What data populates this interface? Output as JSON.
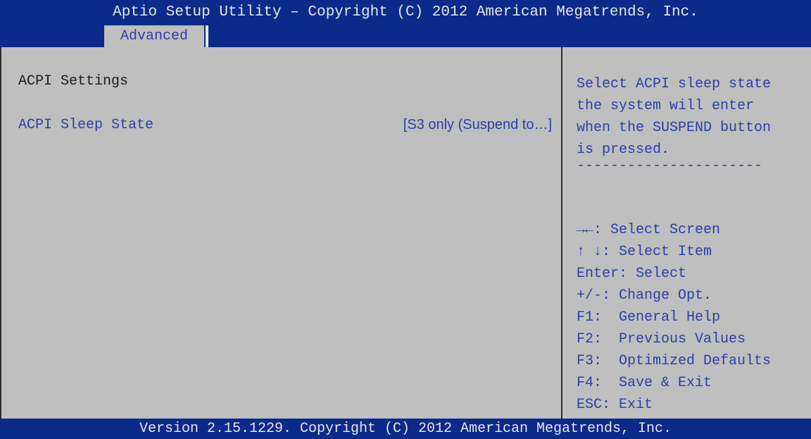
{
  "header": {
    "title": "Aptio Setup Utility – Copyright (C) 2012 American Megatrends, Inc."
  },
  "tabs": [
    {
      "label": "Advanced",
      "selected": true
    }
  ],
  "main": {
    "section_title": "ACPI Settings",
    "settings": [
      {
        "label": "ACPI Sleep State",
        "value": "[S3 only (Suspend to…]"
      }
    ]
  },
  "help": {
    "description_lines": [
      "Select ACPI sleep state",
      "the system will enter",
      "when the SUSPEND button",
      "is pressed."
    ],
    "separator": "----------------------",
    "key_hints": [
      "→←: Select Screen",
      "↑ ↓: Select Item",
      "Enter: Select",
      "+/-: Change Opt.",
      "F1:  General Help",
      "F2:  Previous Values",
      "F3:  Optimized Defaults",
      "F4:  Save & Exit",
      "ESC: Exit"
    ]
  },
  "footer": {
    "version_text": "Version 2.15.1229. Copyright (C) 2012 American Megatrends, Inc."
  },
  "colors": {
    "header_bg": "#0b2a8a",
    "body_bg": "#bfbfbf",
    "accent_text": "#2a3fa8",
    "title_text": "#e6e6e6"
  }
}
